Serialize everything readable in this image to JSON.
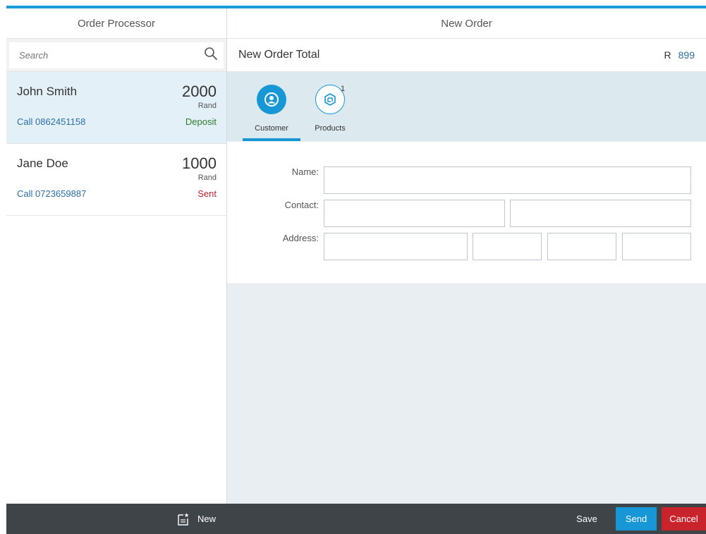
{
  "master": {
    "title": "Order Processor",
    "search_placeholder": "Search",
    "items": [
      {
        "name": "John Smith",
        "number": "2000",
        "unit": "Rand",
        "call": "Call 0862451158",
        "status": "Deposit",
        "status_state": "success",
        "selected": true
      },
      {
        "name": "Jane Doe",
        "number": "1000",
        "unit": "Rand",
        "call": "Call 0723659887",
        "status": "Sent",
        "status_state": "error",
        "selected": false
      }
    ],
    "footer": {
      "new_label": "New",
      "new_icon": "new-document-icon"
    }
  },
  "detail": {
    "title": "New Order",
    "subheader": {
      "title": "New Order Total",
      "currency": "R",
      "amount": "899"
    },
    "tabs": [
      {
        "label": "Customer",
        "icon": "customer-icon",
        "selected": true
      },
      {
        "label": "Products",
        "icon": "product-icon",
        "count": "1",
        "selected": false
      }
    ],
    "form": {
      "name_label": "Name:",
      "contact_label": "Contact:",
      "address_label": "Address:"
    },
    "footer": {
      "save_label": "Save",
      "send_label": "Send",
      "cancel_label": "Cancel"
    }
  },
  "colors": {
    "accent": "#1797d6",
    "top_bar": "#1a9ad6",
    "footer_bg": "#3f4448",
    "cancel": "#c9232b",
    "status_success": "#2b7d2b",
    "status_error": "#c4232b",
    "selected_row": "#e3f0f8",
    "tab_bar": "#dceaf0",
    "link": "#2a6fa8"
  }
}
